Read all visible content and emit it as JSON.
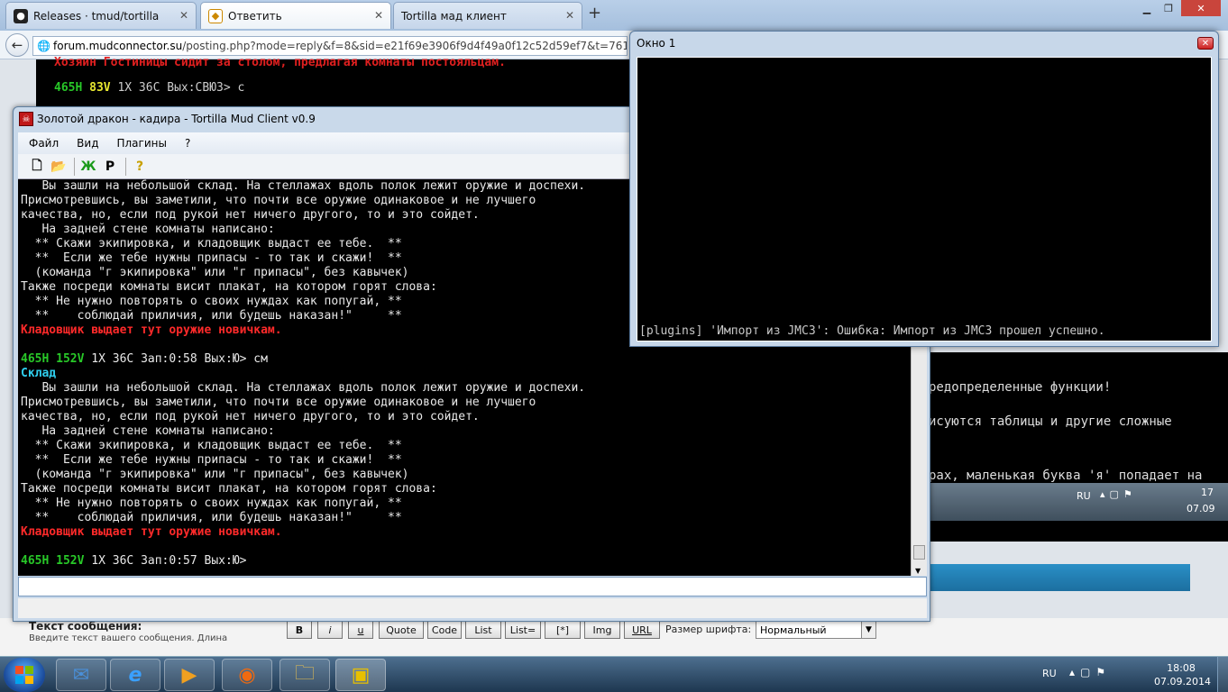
{
  "browser": {
    "tabs": [
      {
        "label": "Releases · tmud/tortilla",
        "icon": "github-icon"
      },
      {
        "label": "Ответить",
        "icon": "forum-icon"
      },
      {
        "label": "Tortilla мад клиент",
        "icon": "blank-page-icon"
      }
    ],
    "url_domain": "forum.mudconnector.su",
    "url_path": "/posting.php?mode=reply&f=8&sid=e21f69e3906f9d4f49a0f12c52d59ef7&t=761"
  },
  "background": {
    "term_line1": "Хозяин Гостиницы сидит за столом, предлагая комнаты постояльцам.",
    "term_prompt_hp": "465H",
    "term_prompt_v": "83V",
    "term_prompt_rest": "1X 36C Вых:СВЮЗ> с",
    "text_line1": "редопределенные функции!",
    "text_line2": "исуются таблицы и другие сложные",
    "text_line3": "рах, маленькая буква 'я' попадает на",
    "inner_lang": "RU",
    "inner_time": "17",
    "inner_date": "07.09",
    "post_label": "Текст сообщения:",
    "post_hint": "Введите текст вашего сообщения. Длина",
    "format_buttons": [
      "B",
      "i",
      "u",
      "Quote",
      "Code",
      "List",
      "List=",
      "[*]",
      "Img",
      "URL"
    ],
    "font_size_label": "Размер шрифта:",
    "font_size_value": "Нормальный"
  },
  "client": {
    "title": "Золотой дракон - кадира - Tortilla Mud Client v0.9",
    "menu": [
      "Файл",
      "Вид",
      "Плагины",
      "?"
    ],
    "output": [
      {
        "cls": "wht",
        "text": "   Вы зашли на небольшой склад. На стеллажах вдоль полок лежит оружие и доспехи."
      },
      {
        "cls": "wht",
        "text": "Присмотревшись, вы заметили, что почти все оружие одинаковое и не лучшего"
      },
      {
        "cls": "wht",
        "text": "качества, но, если под рукой нет ничего другого, то и это сойдет."
      },
      {
        "cls": "wht",
        "text": "   На задней стене комнаты написано:"
      },
      {
        "cls": "wht",
        "text": "  ** Скажи экипировка, и кладовщик выдаст ее тебе.  **"
      },
      {
        "cls": "wht",
        "text": "  **  Если же тебе нужны припасы - то так и скажи!  **"
      },
      {
        "cls": "wht",
        "text": "  (команда \"г экипировка\" или \"г припасы\", без кавычек)"
      },
      {
        "cls": "wht",
        "text": "Также посреди комнаты висит плакат, на котором горят слова:"
      },
      {
        "cls": "wht",
        "text": "  ** Не нужно повторять о своих нуждах как попугай, **"
      },
      {
        "cls": "wht",
        "text": "  **    соблюдай приличия, или будешь наказан!\"     **"
      },
      {
        "cls": "red",
        "text": "Кладовщик выдает тут оружие новичкам."
      },
      {
        "cls": "wht",
        "text": ""
      },
      {
        "cls": "prompt",
        "hp": "465H",
        "v": "152V",
        "text": " 1X 36C Зап:0:58 Вых:Ю> см"
      },
      {
        "cls": "cyan",
        "text": "Склад"
      },
      {
        "cls": "wht",
        "text": "   Вы зашли на небольшой склад. На стеллажах вдоль полок лежит оружие и доспехи."
      },
      {
        "cls": "wht",
        "text": "Присмотревшись, вы заметили, что почти все оружие одинаковое и не лучшего"
      },
      {
        "cls": "wht",
        "text": "качества, но, если под рукой нет ничего другого, то и это сойдет."
      },
      {
        "cls": "wht",
        "text": "   На задней стене комнаты написано:"
      },
      {
        "cls": "wht",
        "text": "  ** Скажи экипировка, и кладовщик выдаст ее тебе.  **"
      },
      {
        "cls": "wht",
        "text": "  **  Если же тебе нужны припасы - то так и скажи!  **"
      },
      {
        "cls": "wht",
        "text": "  (команда \"г экипировка\" или \"г припасы\", без кавычек)"
      },
      {
        "cls": "wht",
        "text": "Также посреди комнаты висит плакат, на котором горят слова:"
      },
      {
        "cls": "wht",
        "text": "  ** Не нужно повторять о своих нуждах как попугай, **"
      },
      {
        "cls": "wht",
        "text": "  **    соблюдай приличия, или будешь наказан!\"     **"
      },
      {
        "cls": "red",
        "text": "Кладовщик выдает тут оружие новичкам."
      },
      {
        "cls": "wht",
        "text": ""
      },
      {
        "cls": "prompt",
        "hp": "465H",
        "v": "152V",
        "text": " 1X 36C Зап:0:57 Вых:Ю>"
      }
    ],
    "input_value": ""
  },
  "okno": {
    "title": "Окно 1",
    "message": "[plugins] 'Импорт из JMC3': Ошибка: Импорт из JMC3 прошел успешно."
  },
  "taskbar": {
    "apps": [
      "thunderbird-icon",
      "internet-explorer-icon",
      "media-player-icon",
      "firefox-icon",
      "explorer-folder-icon",
      "tortilla-icon"
    ],
    "lang": "RU",
    "time": "18:08",
    "date": "07.09.2014"
  },
  "colors": {
    "prompt_hp": "#28c828",
    "prompt_v_low": "#e8e830",
    "room_name": "#2fd0f0",
    "npc_red": "#ff2a2a"
  }
}
